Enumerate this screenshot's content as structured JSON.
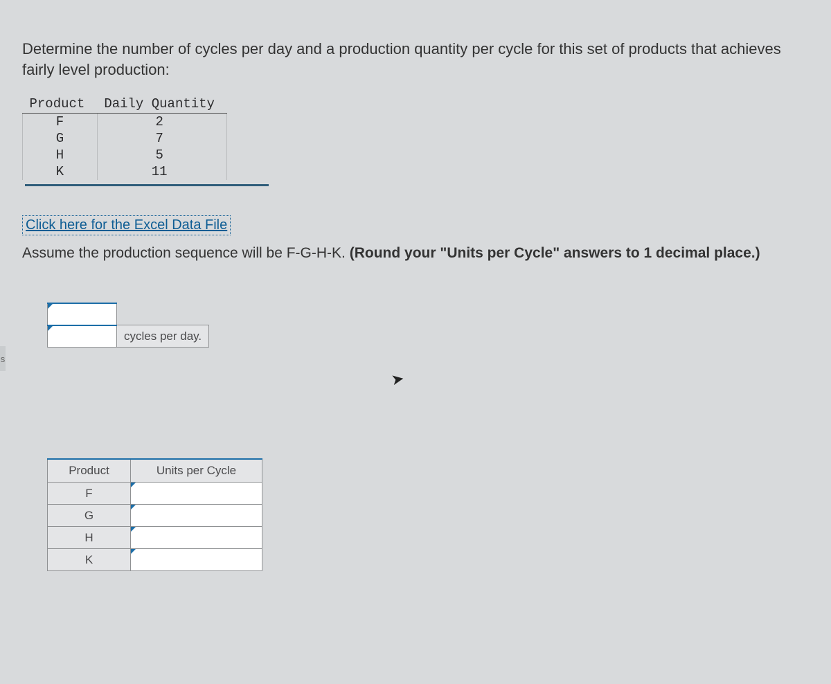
{
  "prompt": "Determine the number of cycles per day and a production quantity per cycle for this set of products that achieves fairly level production:",
  "table1": {
    "headers": {
      "product": "Product",
      "daily_qty": "Daily Quantity"
    },
    "rows": [
      {
        "product": "F",
        "qty": "2"
      },
      {
        "product": "G",
        "qty": "7"
      },
      {
        "product": "H",
        "qty": "5"
      },
      {
        "product": "K",
        "qty": "11"
      }
    ]
  },
  "excel_link": "Click here for the Excel Data File",
  "instruction_pre": "Assume the production sequence will be F-G-H-K. ",
  "instruction_bold": "(Round your \"Units per Cycle\" answers to 1 decimal place.)",
  "cycles_label": "cycles per day.",
  "answer_table": {
    "headers": {
      "product": "Product",
      "units": "Units per Cycle"
    },
    "rows": [
      {
        "product": "F"
      },
      {
        "product": "G"
      },
      {
        "product": "H"
      },
      {
        "product": "K"
      }
    ]
  },
  "left_sliver": "s"
}
